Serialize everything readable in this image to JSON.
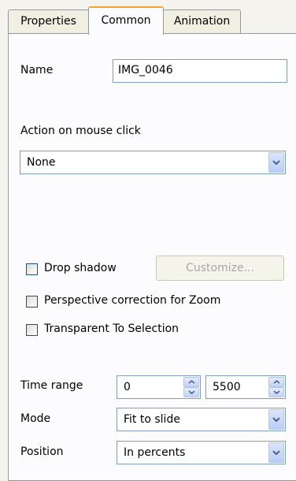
{
  "tabs": [
    {
      "label": "Properties",
      "active": false
    },
    {
      "label": "Common",
      "active": true
    },
    {
      "label": "Animation",
      "active": false
    }
  ],
  "name": {
    "label": "Name",
    "value": "IMG_0046"
  },
  "action": {
    "label": "Action on mouse click",
    "selected": "None"
  },
  "drop_shadow": {
    "label": "Drop shadow",
    "checked": false,
    "customize_label": "Customize..."
  },
  "perspective": {
    "label": "Perspective correction for Zoom",
    "checked": false
  },
  "transparent": {
    "label": "Transparent To Selection",
    "checked": false
  },
  "time_range": {
    "label": "Time range",
    "start": "0",
    "end": "5500"
  },
  "mode": {
    "label": "Mode",
    "selected": "Fit to slide"
  },
  "position": {
    "label": "Position",
    "selected": "In percents"
  },
  "icons": {
    "dropdown": "chevron-down-icon",
    "spin_up": "arrow-up-icon",
    "spin_down": "arrow-down-icon"
  },
  "colors": {
    "active_tab_accent": "#f0a530",
    "control_border": "#7f9db9",
    "panel_bg": "#fcfcfe"
  }
}
